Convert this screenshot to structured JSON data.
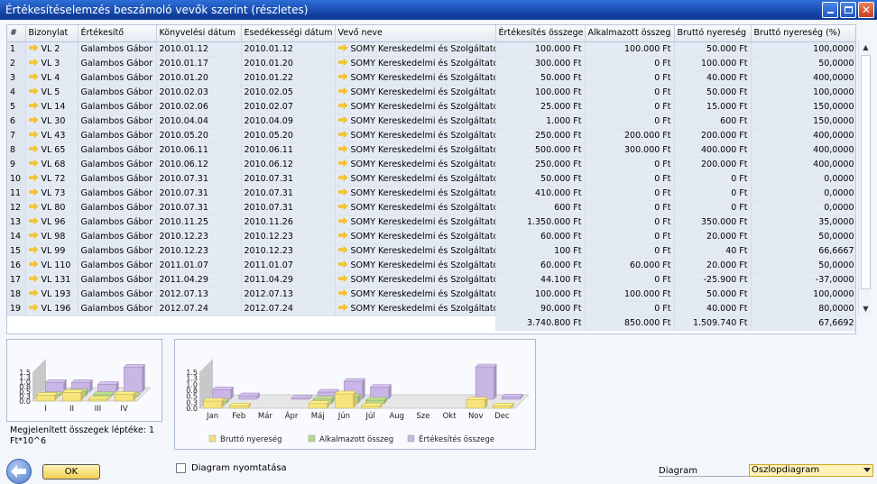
{
  "window": {
    "title": "Értékesítéselemzés beszámoló vevők szerint (részletes)"
  },
  "table": {
    "columns": [
      "#",
      "Bizonylat",
      "Értékesítő",
      "Könyvelési dátum",
      "Esedékességi dátum",
      "Vevő neve",
      "Értékesítés összege",
      "Alkalmazott összeg",
      "Bruttó nyereség",
      "Bruttó nyereség (%)"
    ],
    "rows": [
      [
        "1",
        "VL 2",
        "Galambos Gábor",
        "2010.01.12",
        "2010.01.12",
        "SOMY Kereskedelmi és Szolgáltató K",
        "100.000 Ft",
        "100.000 Ft",
        "50.000 Ft",
        "100,0000"
      ],
      [
        "2",
        "VL 3",
        "Galambos Gábor",
        "2010.01.17",
        "2010.01.20",
        "SOMY Kereskedelmi és Szolgáltató K",
        "300.000 Ft",
        "0 Ft",
        "100.000 Ft",
        "50,0000"
      ],
      [
        "3",
        "VL 4",
        "Galambos Gábor",
        "2010.01.20",
        "2010.01.22",
        "SOMY Kereskedelmi és Szolgáltató K",
        "50.000 Ft",
        "0 Ft",
        "40.000 Ft",
        "400,0000"
      ],
      [
        "4",
        "VL 5",
        "Galambos Gábor",
        "2010.02.03",
        "2010.02.05",
        "SOMY Kereskedelmi és Szolgáltató K",
        "100.000 Ft",
        "0 Ft",
        "50.000 Ft",
        "100,0000"
      ],
      [
        "5",
        "VL 14",
        "Galambos Gábor",
        "2010.02.06",
        "2010.02.07",
        "SOMY Kereskedelmi és Szolgáltató K",
        "25.000 Ft",
        "0 Ft",
        "15.000 Ft",
        "150,0000"
      ],
      [
        "6",
        "VL 30",
        "Galambos Gábor",
        "2010.04.04",
        "2010.04.09",
        "SOMY Kereskedelmi és Szolgáltató K",
        "1.000 Ft",
        "0 Ft",
        "600 Ft",
        "150,0000"
      ],
      [
        "7",
        "VL 43",
        "Galambos Gábor",
        "2010.05.20",
        "2010.05.20",
        "SOMY Kereskedelmi és Szolgáltató K",
        "250.000 Ft",
        "200.000 Ft",
        "200.000 Ft",
        "400,0000"
      ],
      [
        "8",
        "VL 65",
        "Galambos Gábor",
        "2010.06.11",
        "2010.06.11",
        "SOMY Kereskedelmi és Szolgáltató K",
        "500.000 Ft",
        "300.000 Ft",
        "400.000 Ft",
        "400,0000"
      ],
      [
        "9",
        "VL 68",
        "Galambos Gábor",
        "2010.06.12",
        "2010.06.12",
        "SOMY Kereskedelmi és Szolgáltató K",
        "250.000 Ft",
        "0 Ft",
        "200.000 Ft",
        "400,0000"
      ],
      [
        "10",
        "VL 72",
        "Galambos Gábor",
        "2010.07.31",
        "2010.07.31",
        "SOMY Kereskedelmi és Szolgáltató K",
        "50.000 Ft",
        "0 Ft",
        "0 Ft",
        "0,0000"
      ],
      [
        "11",
        "VL 73",
        "Galambos Gábor",
        "2010.07.31",
        "2010.07.31",
        "SOMY Kereskedelmi és Szolgáltató K",
        "410.000 Ft",
        "0 Ft",
        "0 Ft",
        "0,0000"
      ],
      [
        "12",
        "VL 80",
        "Galambos Gábor",
        "2010.07.31",
        "2010.07.31",
        "SOMY Kereskedelmi és Szolgáltató K",
        "600 Ft",
        "0 Ft",
        "0 Ft",
        "0,0000"
      ],
      [
        "13",
        "VL 96",
        "Galambos Gábor",
        "2010.11.25",
        "2010.11.26",
        "SOMY Kereskedelmi és Szolgáltató K",
        "1.350.000 Ft",
        "0 Ft",
        "350.000 Ft",
        "35,0000"
      ],
      [
        "14",
        "VL 98",
        "Galambos Gábor",
        "2010.12.23",
        "2010.12.23",
        "SOMY Kereskedelmi és Szolgáltató K",
        "60.000 Ft",
        "0 Ft",
        "20.000 Ft",
        "50,0000"
      ],
      [
        "15",
        "VL 99",
        "Galambos Gábor",
        "2010.12.23",
        "2010.12.23",
        "SOMY Kereskedelmi és Szolgáltató K",
        "100 Ft",
        "0 Ft",
        "40 Ft",
        "66,6667"
      ],
      [
        "16",
        "VL 110",
        "Galambos Gábor",
        "2011.01.07",
        "2011.01.07",
        "SOMY Kereskedelmi és Szolgáltató K",
        "60.000 Ft",
        "60.000 Ft",
        "20.000 Ft",
        "50,0000"
      ],
      [
        "17",
        "VL 131",
        "Galambos Gábor",
        "2011.04.29",
        "2011.04.29",
        "SOMY Kereskedelmi és Szolgáltató K",
        "44.100 Ft",
        "0 Ft",
        "-25.900 Ft",
        "-37,0000"
      ],
      [
        "18",
        "VL 193",
        "Galambos Gábor",
        "2012.07.13",
        "2012.07.13",
        "SOMY Kereskedelmi és Szolgáltató K",
        "100.000 Ft",
        "100.000 Ft",
        "50.000 Ft",
        "100,0000"
      ],
      [
        "19",
        "VL 196",
        "Galambos Gábor",
        "2012.07.24",
        "2012.07.24",
        "SOMY Kereskedelmi és Szolgáltató K",
        "90.000 Ft",
        "0 Ft",
        "40.000 Ft",
        "80,0000"
      ]
    ],
    "totals": [
      "3.740.800 Ft",
      "850.000 Ft",
      "1.509.740 Ft",
      "67,6692"
    ]
  },
  "chart_data": [
    {
      "type": "bar",
      "categories": [
        "I",
        "II",
        "III",
        "IV"
      ],
      "series": [
        {
          "name": "Bruttó nyereség",
          "values": [
            0.3,
            0.45,
            0.1,
            0.35
          ]
        },
        {
          "name": "Alkalmazott összeg",
          "values": [
            0.1,
            0.25,
            0.1,
            0.05
          ]
        },
        {
          "name": "Értékesítés összege",
          "values": [
            0.5,
            0.5,
            0.4,
            1.3
          ]
        }
      ],
      "y_ticks": [
        "0.0",
        "0.3",
        "0.5",
        "0.8",
        "1.0",
        "1.3",
        "1.5"
      ],
      "ylim": [
        0,
        1.5
      ],
      "style": "3d"
    },
    {
      "type": "bar",
      "categories": [
        "Jan",
        "Feb",
        "Már",
        "Ápr",
        "Máj",
        "Jún",
        "Júl",
        "Aug",
        "Sze",
        "Okt",
        "Nov",
        "Dec"
      ],
      "series": [
        {
          "name": "Bruttó nyereség",
          "values": [
            0.3,
            0.1,
            0.0,
            0.0,
            0.2,
            0.6,
            0.1,
            0.0,
            0.0,
            0.0,
            0.35,
            0.1
          ]
        },
        {
          "name": "Alkalmazott összeg",
          "values": [
            0.1,
            0.0,
            0.0,
            0.0,
            0.2,
            0.3,
            0.15,
            0.0,
            0.0,
            0.0,
            0.0,
            0.0
          ]
        },
        {
          "name": "Értékesítés összege",
          "values": [
            0.4,
            0.15,
            0.0,
            0.05,
            0.3,
            0.75,
            0.5,
            0.0,
            0.0,
            0.0,
            1.35,
            0.1
          ]
        }
      ],
      "y_ticks": [
        "0.0",
        "0.3",
        "0.5",
        "0.8",
        "1.0",
        "1.3",
        "1.5"
      ],
      "ylim": [
        0,
        1.5
      ],
      "style": "3d",
      "legend": "bottom"
    }
  ],
  "colors": {
    "Bruttó nyereség": "#f7e37c",
    "Alkalmazott összeg": "#b7d88a",
    "Értékesítés összege": "#c9b6e6"
  },
  "scale_note": "Megjelenített összegek léptéke: 1 Ft*10^6",
  "buttons": {
    "ok": "OK"
  },
  "print_checkbox": {
    "label": "Diagram nyomtatása",
    "checked": false
  },
  "diagram_select": {
    "label": "Diagram",
    "value": "Oszlopdiagram"
  }
}
